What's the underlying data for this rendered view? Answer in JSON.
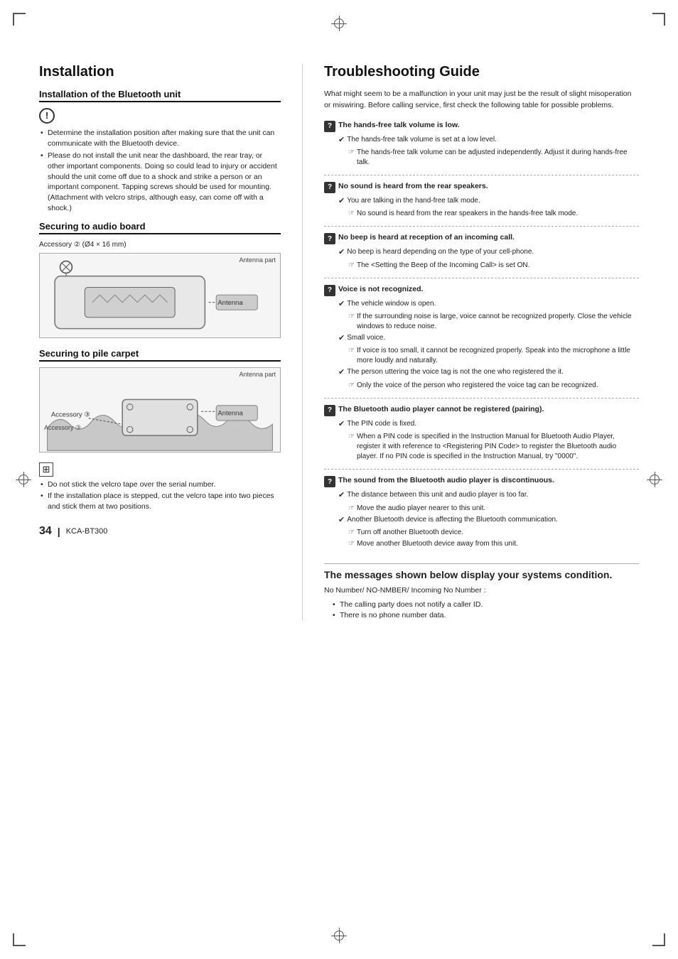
{
  "page": {
    "corners": true,
    "crosshairs": true
  },
  "left": {
    "title": "Installation",
    "subsection1_title": "Installation of the Bluetooth unit",
    "warning_icon": "⚠",
    "warning_bullets": [
      "Determine the installation position after making sure that the unit can communicate with the Bluetooth device.",
      "Please do not install the unit near the dashboard, the rear tray, or other important components. Doing so could lead to injury or accident should the unit come off due to a shock and strike a person or an important component. Tapping screws should be used for mounting. (Attachment with velcro strips, although easy, can come off with a shock.)"
    ],
    "subsection2_title": "Securing to audio board",
    "diagram1_label": "Accessory ② (Ø4 × 16 mm)",
    "diagram1_antenna": "Antenna part",
    "subsection3_title": "Securing to pile carpet",
    "diagram2_antenna": "Antenna part",
    "diagram2_accessory": "Accessory ③",
    "note_icon": "⊞",
    "note_bullets": [
      "Do not stick the velcro tape over the serial number.",
      "If the installation place is stepped, cut the velcro tape into two pieces and stick them at two positions."
    ],
    "page_number": "34",
    "model": "KCA-BT300"
  },
  "right": {
    "title": "Troubleshooting Guide",
    "intro": "What might seem to be a malfunction in your unit may just be the result of slight misoperation or miswiring. Before calling service, first check the following table for possible problems.",
    "items": [
      {
        "id": "q1",
        "title": "The hands-free talk volume is low.",
        "checks": [
          {
            "text": "The hands-free talk volume is set at a low level.",
            "sub": "The hands-free talk volume can be adjusted independently. Adjust it during hands-free talk."
          }
        ]
      },
      {
        "id": "q2",
        "title": "No sound is heard from the rear speakers.",
        "checks": [
          {
            "text": "You are talking in the hand-free talk mode.",
            "sub": "No sound is heard from the rear speakers in the hands-free talk mode."
          }
        ]
      },
      {
        "id": "q3",
        "title": "No beep is heard at reception of an incoming call.",
        "checks": [
          {
            "text": "No beep is heard depending on the type of your cell-phone.",
            "sub": "The <Setting the Beep of the Incoming Call> is set ON."
          }
        ]
      },
      {
        "id": "q4",
        "title": "Voice is not recognized.",
        "checks": [
          {
            "text": "The vehicle window is open.",
            "sub": "If the surrounding noise is large, voice cannot be recognized properly. Close the vehicle windows to reduce noise."
          },
          {
            "text": "Small voice.",
            "sub": "If voice is too small, it cannot be recognized properly. Speak into the microphone a little more loudly and naturally."
          },
          {
            "text": "The person uttering the voice tag is not the one who registered the it.",
            "sub": "Only the voice of the person who registered the voice tag can be recognized."
          }
        ]
      },
      {
        "id": "q5",
        "title": "The Bluetooth audio player cannot be registered (pairing).",
        "checks": [
          {
            "text": "The PIN code is fixed.",
            "sub": "When a PIN code is specified in the Instruction Manual for Bluetooth Audio Player, register it with reference to <Registering PIN Code> to register the Bluetooth audio player. If no PIN code is specified in the Instruction Manual, try \"0000\"."
          }
        ]
      },
      {
        "id": "q6",
        "title": "The sound from the Bluetooth audio player is discontinuous.",
        "checks": [
          {
            "text": "The distance between this unit and audio player is too far.",
            "sub": "Move the audio player nearer to this unit."
          },
          {
            "text": "Another Bluetooth device is affecting the Bluetooth communication.",
            "subs": [
              "Turn off another Bluetooth device.",
              "Move another Bluetooth device away from this unit."
            ]
          }
        ]
      }
    ],
    "messages_title": "The messages shown below display your systems condition.",
    "messages_label": "No Number/ NO-NMBER/ Incoming No Number :",
    "messages_details": [
      "The calling party does not notify a caller ID.",
      "There is no phone number data."
    ]
  }
}
